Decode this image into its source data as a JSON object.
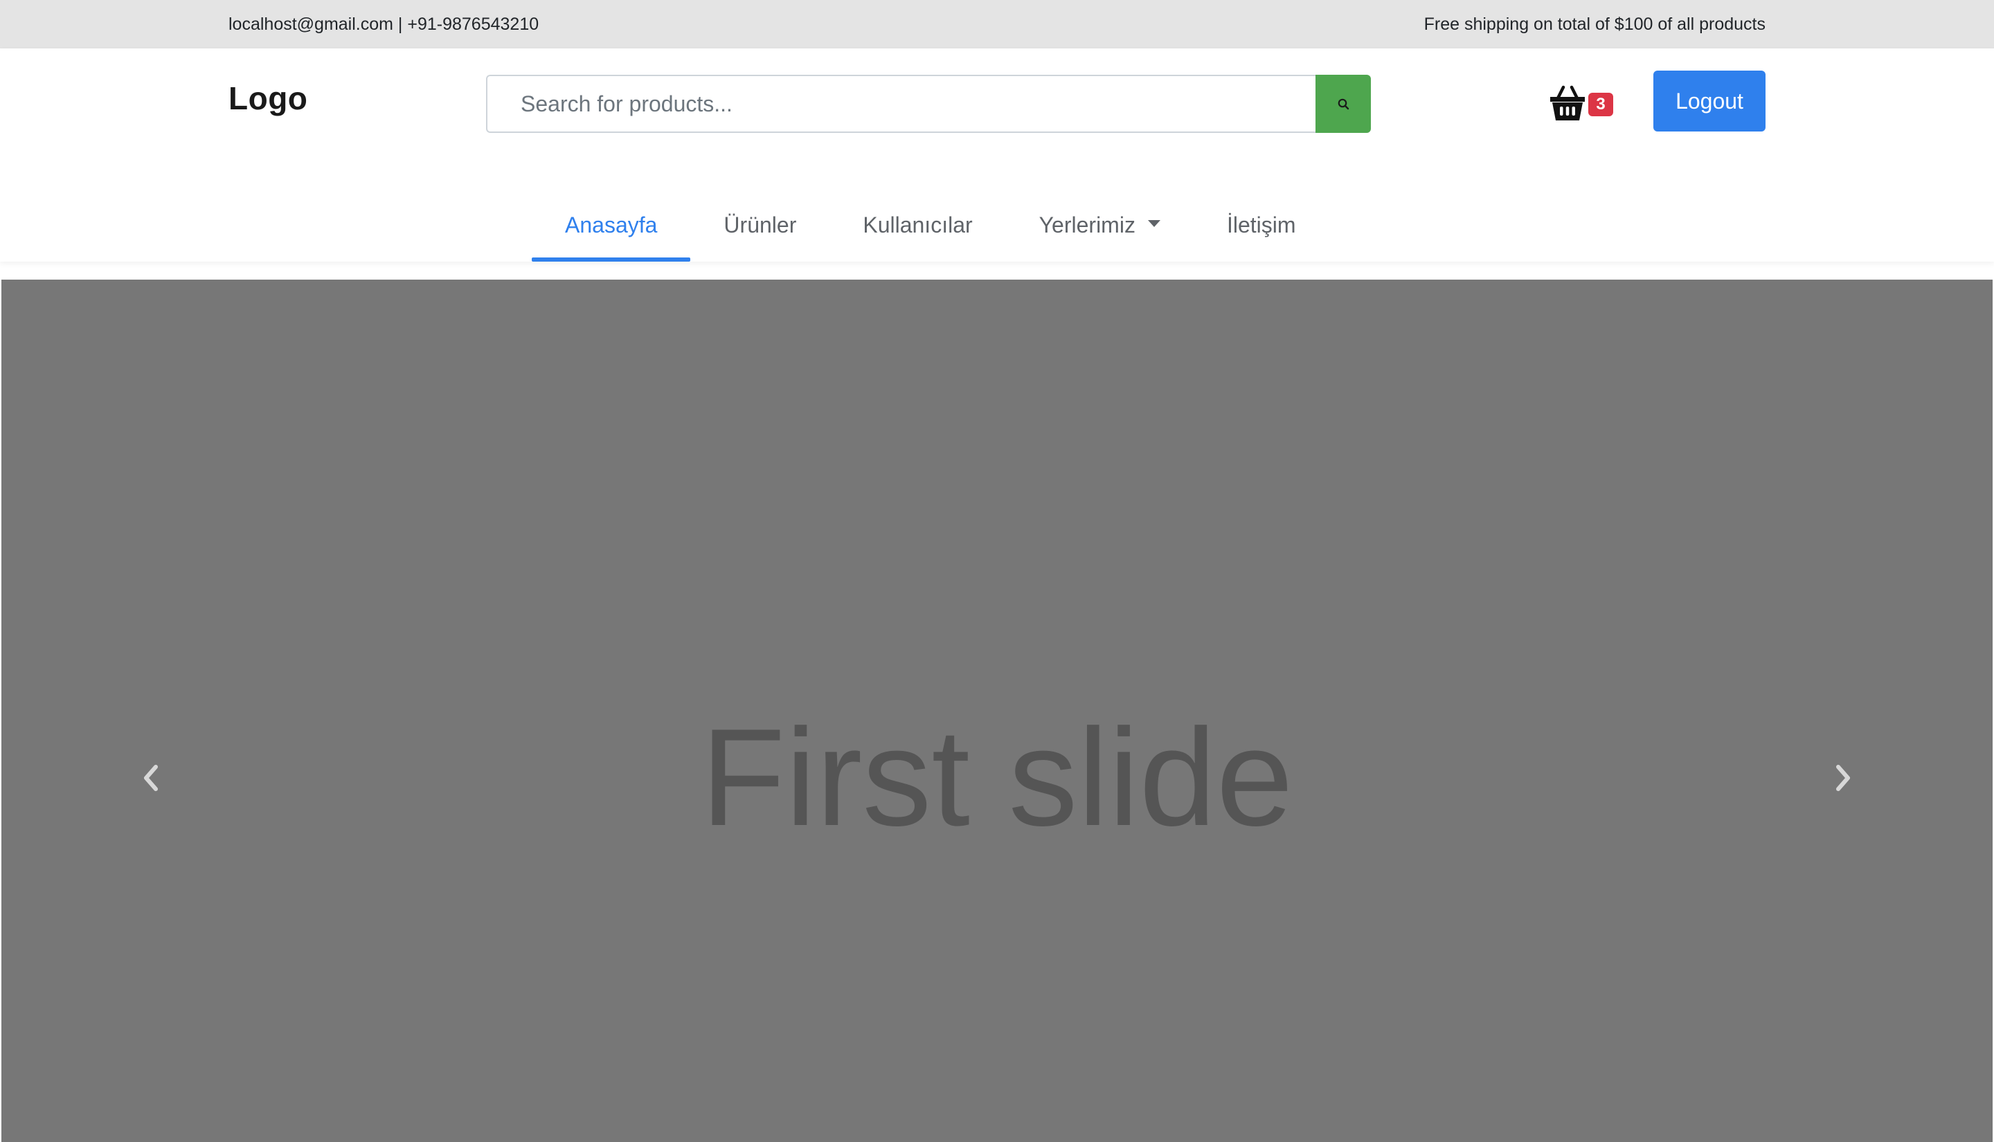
{
  "topbar": {
    "contact": "localhost@gmail.com | +91-9876543210",
    "shipping": "Free shipping on total of $100 of all products"
  },
  "header": {
    "logo": "Logo",
    "search": {
      "placeholder": "Search for products...",
      "value": "",
      "button_icon": "search-icon"
    },
    "cart": {
      "icon": "basket-icon",
      "count": "3"
    },
    "logout_label": "Logout"
  },
  "nav": {
    "items": [
      {
        "label": "Anasayfa",
        "active": true
      },
      {
        "label": "Ürünler",
        "active": false
      },
      {
        "label": "Kullanıcılar",
        "active": false
      },
      {
        "label": "Yerlerimiz",
        "active": false,
        "dropdown": true
      },
      {
        "label": "İletişim",
        "active": false
      }
    ]
  },
  "carousel": {
    "slide_label": "First slide",
    "prev_icon": "chevron-left-icon",
    "next_icon": "chevron-right-icon"
  },
  "colors": {
    "topbar_bg": "#e4e4e4",
    "accent": "#2f80ed",
    "search_button": "#4ea64e",
    "badge": "#dc3545",
    "carousel_bg": "#777777"
  }
}
